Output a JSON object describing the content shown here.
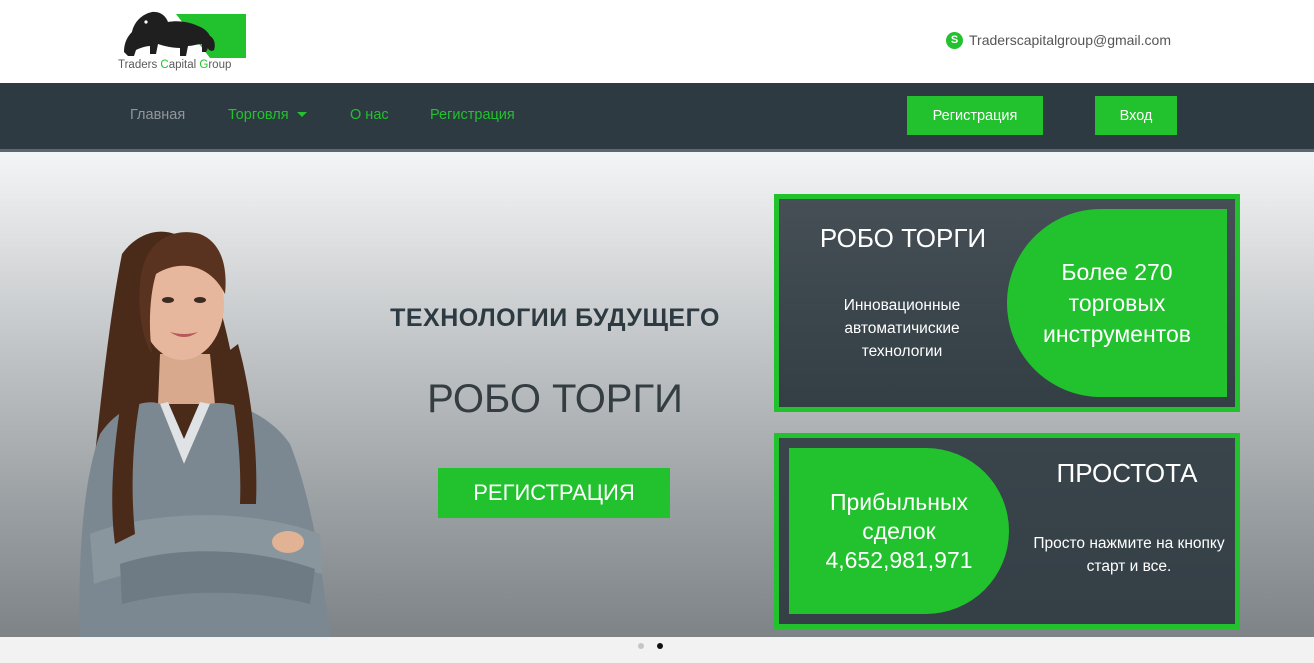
{
  "brand": {
    "logo_text_part1": "Traders ",
    "logo_text_c": "C",
    "logo_text_part2": "apital ",
    "logo_text_g": "G",
    "logo_text_part3": "roup",
    "accent_color": "#22c12e",
    "nav_color": "#2e3a41"
  },
  "contact": {
    "icon": "skype-icon",
    "email": "Traderscapitalgroup@gmail.com"
  },
  "nav": {
    "items": [
      {
        "label": "Главная"
      },
      {
        "label": "Торговля"
      },
      {
        "label": "О нас"
      },
      {
        "label": "Регистрация"
      }
    ],
    "register_button": "Регистрация",
    "login_button": "Вход"
  },
  "hero": {
    "heading": "ТЕХНОЛОГИИ БУДУЩЕГО",
    "subheading": "РОБО ТОРГИ",
    "cta": "РЕГИСТРАЦИЯ"
  },
  "card1": {
    "title": "РОБО ТОРГИ",
    "text": "Инновационные автоматичиские технологии",
    "highlight": "Более 270 торговых инструментов"
  },
  "card2": {
    "highlight_label": "Прибыльных сделок",
    "highlight_value": "4,652,981,971",
    "title": "ПРОСТОТА",
    "text": "Просто нажмите на кнопку старт и все."
  }
}
